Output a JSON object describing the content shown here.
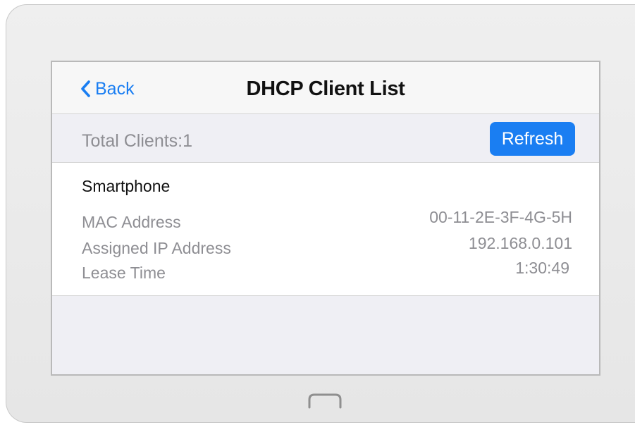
{
  "navbar": {
    "back_label": "Back",
    "title": "DHCP Client List"
  },
  "summary": {
    "total_label": "Total Clients:1",
    "refresh_label": "Refresh"
  },
  "client": {
    "name": "Smartphone",
    "fields": [
      {
        "label": "MAC Address",
        "value": "00-11-2E-3F-4G-5H"
      },
      {
        "label": "Assigned IP Address",
        "value": "192.168.0.101"
      },
      {
        "label": "Lease Time",
        "value": "1:30:49"
      }
    ]
  },
  "icons": {
    "back": "chevron-left-icon",
    "home": "home-button-icon"
  },
  "colors": {
    "accent": "#1a7ef2",
    "secondary_text": "#8e8e93",
    "primary_text": "#111111",
    "background": "#efeff4"
  }
}
